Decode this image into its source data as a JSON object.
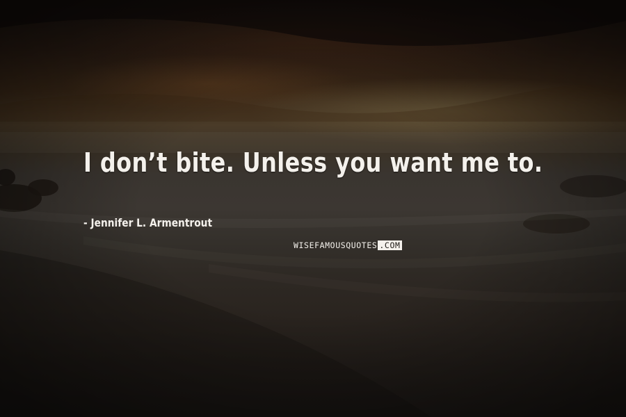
{
  "quote": {
    "text": "I don’t bite. Unless you want me to.",
    "author": "- Jennifer L. Armentrout"
  },
  "watermark": {
    "brand_light": "WISEFAMOUSQUOTES",
    "brand_dark": ".COM"
  },
  "colors": {
    "text": "#f4f1ec",
    "background_dark": "#1a1612",
    "sky_warm": "#4a3b28"
  }
}
